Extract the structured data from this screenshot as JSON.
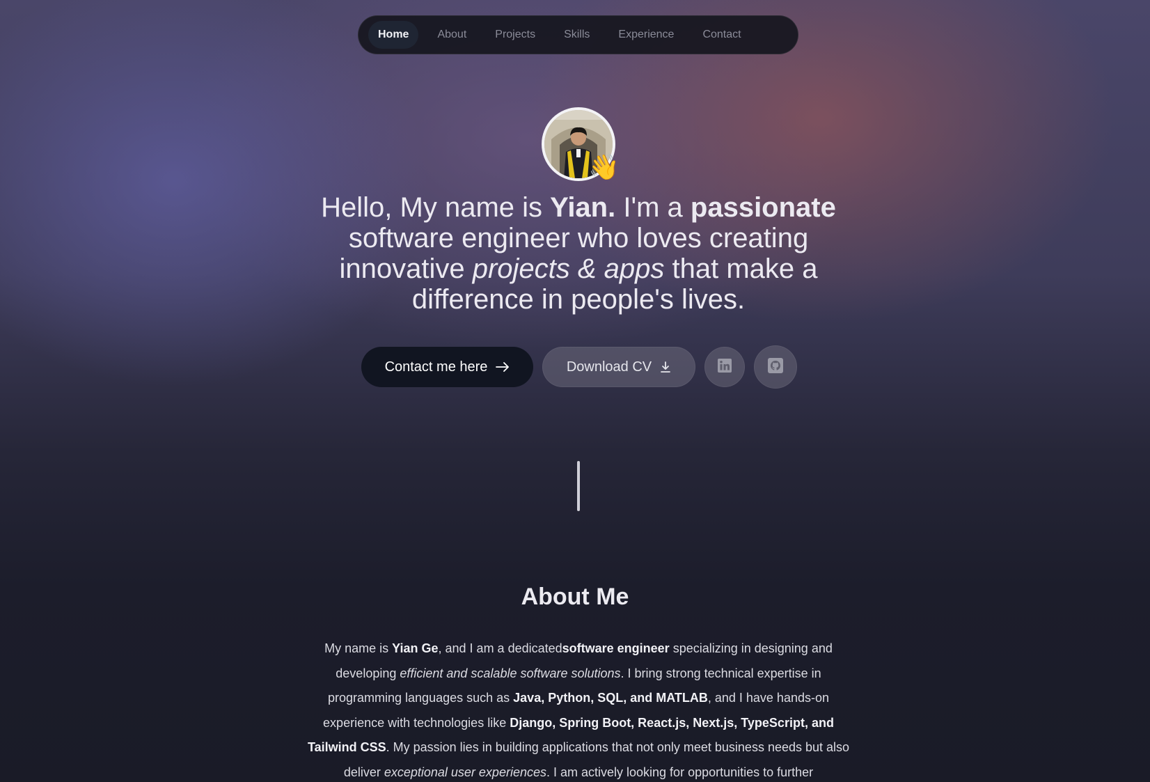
{
  "nav": {
    "items": [
      {
        "label": "Home",
        "active": true
      },
      {
        "label": "About",
        "active": false
      },
      {
        "label": "Projects",
        "active": false
      },
      {
        "label": "Skills",
        "active": false
      },
      {
        "label": "Experience",
        "active": false
      },
      {
        "label": "Contact",
        "active": false
      }
    ]
  },
  "hero": {
    "avatar_emoji": "👋",
    "headline": {
      "p1": "Hello, My name is ",
      "name": "Yian.",
      "p2": " I'm a ",
      "passionate": "passionate",
      "p3": " software engineer who loves creating innovative ",
      "projects": "projects & apps",
      "p4": " that make a difference in people's lives."
    },
    "buttons": {
      "contact_label": "Contact me here",
      "contact_icon": "arrow-right-icon",
      "cv_label": "Download CV",
      "cv_icon": "download-icon",
      "linkedin_icon": "linkedin-icon",
      "github_icon": "github-icon"
    }
  },
  "about": {
    "title": "About Me",
    "t1": "My name is ",
    "b1": "Yian Ge",
    "t2": ", and I am a dedicated",
    "b2": "software engineer",
    "t3": " specializing in designing and developing ",
    "i1": "efficient and scalable software solutions",
    "t4": ". I bring strong technical expertise in programming languages such as ",
    "b3": "Java, Python, SQL, and MATLAB",
    "t5": ", and I have hands-on experience with technologies like ",
    "b4": "Django, Spring Boot, React.js, Next.js, TypeScript, and Tailwind CSS",
    "t6": ". My passion lies in building applications that not only meet business needs but also deliver ",
    "i2": "exceptional user experiences",
    "t7": ". I am actively looking for opportunities to further"
  },
  "colors": {
    "nav_bg": "#16161e",
    "primary_button": "#111521",
    "text": "#eceaf1"
  }
}
